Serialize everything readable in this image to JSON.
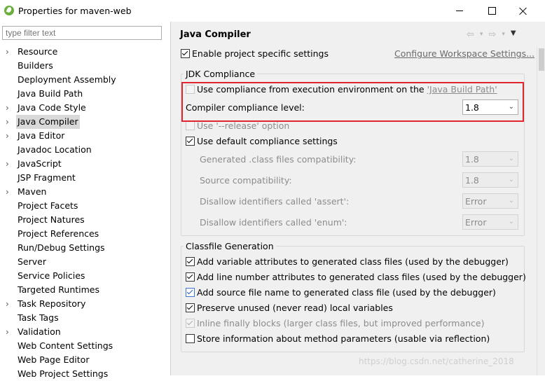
{
  "window": {
    "title": "Properties for maven-web"
  },
  "filter": {
    "placeholder": "type filter text"
  },
  "tree": [
    {
      "label": "Resource",
      "expandable": true
    },
    {
      "label": "Builders",
      "expandable": false
    },
    {
      "label": "Deployment Assembly",
      "expandable": false
    },
    {
      "label": "Java Build Path",
      "expandable": false
    },
    {
      "label": "Java Code Style",
      "expandable": true
    },
    {
      "label": "Java Compiler",
      "expandable": true,
      "selected": true
    },
    {
      "label": "Java Editor",
      "expandable": true
    },
    {
      "label": "Javadoc Location",
      "expandable": false
    },
    {
      "label": "JavaScript",
      "expandable": true
    },
    {
      "label": "JSP Fragment",
      "expandable": false
    },
    {
      "label": "Maven",
      "expandable": true
    },
    {
      "label": "Project Facets",
      "expandable": false
    },
    {
      "label": "Project Natures",
      "expandable": false
    },
    {
      "label": "Project References",
      "expandable": false
    },
    {
      "label": "Run/Debug Settings",
      "expandable": false
    },
    {
      "label": "Server",
      "expandable": false
    },
    {
      "label": "Service Policies",
      "expandable": false
    },
    {
      "label": "Targeted Runtimes",
      "expandable": false
    },
    {
      "label": "Task Repository",
      "expandable": true
    },
    {
      "label": "Task Tags",
      "expandable": false
    },
    {
      "label": "Validation",
      "expandable": true
    },
    {
      "label": "Web Content Settings",
      "expandable": false
    },
    {
      "label": "Web Page Editor",
      "expandable": false
    },
    {
      "label": "Web Project Settings",
      "expandable": false
    }
  ],
  "page": {
    "title": "Java Compiler",
    "enable_project_specific": "Enable project specific settings",
    "configure_workspace_link": "Configure Workspace Settings..."
  },
  "jdk": {
    "group_title": "JDK Compliance",
    "use_compliance_prefix": "Use compliance from execution environment on the ",
    "use_compliance_link": "'Java Build Path'",
    "compiler_level_label": "Compiler compliance level:",
    "compiler_level_value": "1.8",
    "release_option": "Use '--release' option",
    "use_default": "Use default compliance settings",
    "generated_label": "Generated .class files compatibility:",
    "generated_value": "1.8",
    "source_label": "Source compatibility:",
    "source_value": "1.8",
    "assert_label": "Disallow identifiers called 'assert':",
    "assert_value": "Error",
    "enum_label": "Disallow identifiers called 'enum':",
    "enum_value": "Error"
  },
  "classfile": {
    "group_title": "Classfile Generation",
    "opt1": "Add variable attributes to generated class files (used by the debugger)",
    "opt2": "Add line number attributes to generated class files (used by the debugger)",
    "opt3": "Add source file name to generated class file (used by the debugger)",
    "opt4": "Preserve unused (never read) local variables",
    "opt5": "Inline finally blocks (larger class files, but improved performance)",
    "opt6": "Store information about method parameters (usable via reflection)"
  },
  "watermark": "https://blog.csdn.net/catherine_2018",
  "colors": {
    "highlight_border": "#e0252f",
    "selection": "#d9d9d9"
  }
}
